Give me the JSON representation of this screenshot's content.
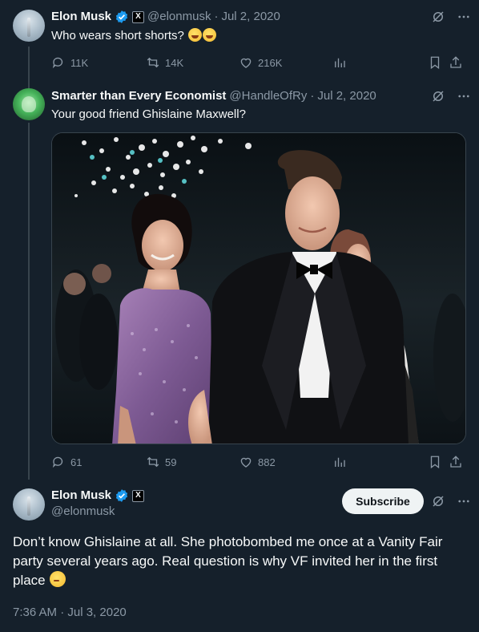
{
  "tweet1": {
    "name": "Elon Musk",
    "handle": "@elonmusk",
    "sep": "·",
    "date": "Jul 2, 2020",
    "text": "Who wears short shorts?",
    "emojis": [
      "rolling-on-floor-laughing",
      "rolling-on-floor-laughing"
    ],
    "replies": "11K",
    "reposts": "14K",
    "likes": "216K"
  },
  "tweet2": {
    "name": "Smarter than Every Economist",
    "handle": "@HandleOfRy",
    "sep": "·",
    "date": "Jul 2, 2020",
    "text": "Your good friend Ghislaine Maxwell?",
    "replies": "61",
    "reposts": "59",
    "likes": "882"
  },
  "main": {
    "name": "Elon Musk",
    "handle": "@elonmusk",
    "subscribe_label": "Subscribe",
    "text": "Don’t know Ghislaine at all. She photobombed me once at a Vanity Fair party several years ago. Real question is why VF invited her in the first place",
    "emoji": "thinking-face",
    "timestamp": "7:36 AM · Jul 3, 2020"
  },
  "colors": {
    "background": "#15202b",
    "text": "#f7f9f9",
    "muted": "#8b98a5",
    "verified": "#1d9bf0",
    "border": "#38444d"
  }
}
